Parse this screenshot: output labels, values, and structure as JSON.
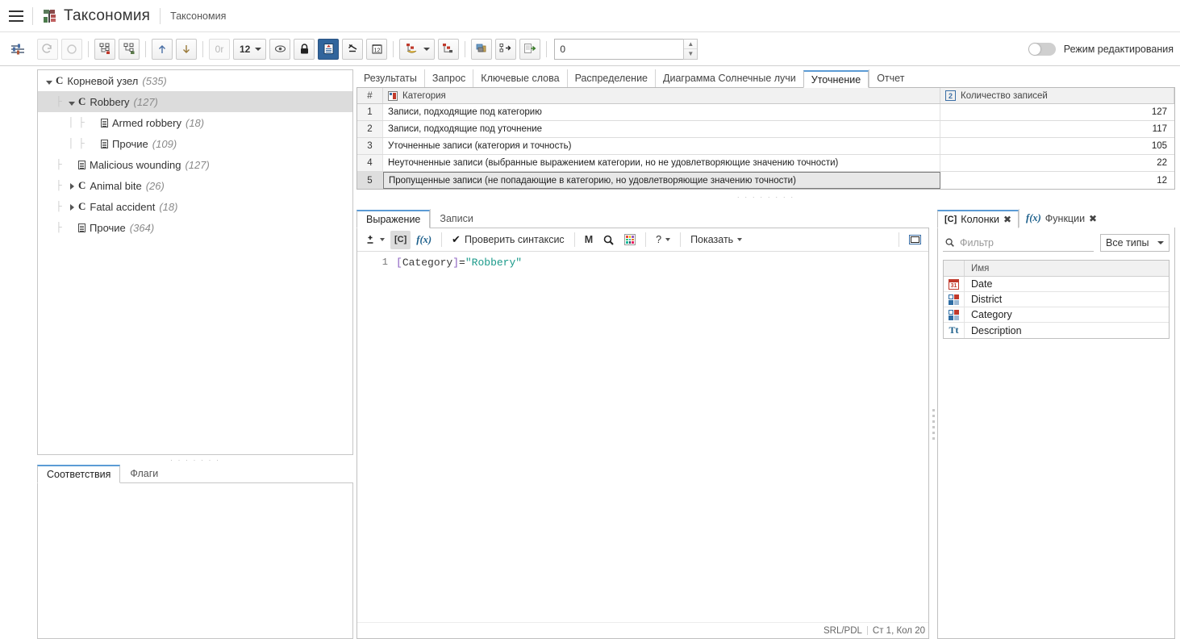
{
  "header": {
    "menu_icon": "hamburger-icon",
    "app_icon": "taxonomy-icon",
    "title": "Таксономия",
    "breadcrumb": "Таксономия"
  },
  "toolbar": {
    "settings_icon": "sliders-icon",
    "buttons": [
      {
        "name": "redo-button",
        "icon": "redo-icon",
        "glyph": "↻",
        "disabled": true
      },
      {
        "name": "undo-button",
        "icon": "undo-icon",
        "glyph": "↺",
        "disabled": true
      },
      {
        "name": "add-child-node-button",
        "icon": "add-node-icon",
        "glyph": "",
        "disabled": false
      },
      {
        "name": "add-sibling-node-button",
        "icon": "add-sibling-icon",
        "glyph": "",
        "disabled": false
      },
      {
        "name": "move-up-button",
        "icon": "arrow-up-icon",
        "glyph": "↑",
        "disabled": false
      },
      {
        "name": "move-down-button",
        "icon": "arrow-down-icon",
        "glyph": "↓",
        "disabled": false
      },
      {
        "name": "or-button",
        "icon": "or-icon",
        "glyph": "0r",
        "disabled": true
      }
    ],
    "precision_value": "12",
    "eye_icon": "eye-icon",
    "lock_icon": "lock-icon",
    "records_icon": "records-icon",
    "ratio_icon": "ratio-icon",
    "calendar12_icon": "calendar-12-icon",
    "node_tools_icon": "node-tools-icon",
    "node_export_icon": "node-export-icon",
    "layers_icon": "layers-icon",
    "node_arrow_icon": "node-arrow-icon",
    "report_icon": "report-export-icon",
    "spinner_value": "0",
    "edit_mode_label": "Режим редактирования",
    "edit_mode_on": false
  },
  "tree": {
    "nodes": [
      {
        "depth": 0,
        "expander": "down",
        "icon": "category-icon",
        "label": "Корневой узел",
        "count": "(535)",
        "selected": false
      },
      {
        "depth": 1,
        "expander": "down",
        "icon": "category-icon",
        "label": "Robbery",
        "count": "(127)",
        "selected": true
      },
      {
        "depth": 2,
        "expander": "none",
        "icon": "record-icon",
        "label": "Armed robbery",
        "count": "(18)",
        "selected": false
      },
      {
        "depth": 2,
        "expander": "none",
        "icon": "record-icon",
        "label": "Прочие",
        "count": "(109)",
        "selected": false
      },
      {
        "depth": 1,
        "expander": "none",
        "icon": "record-icon",
        "label": "Malicious wounding",
        "count": "(127)",
        "selected": false
      },
      {
        "depth": 1,
        "expander": "right",
        "icon": "category-icon",
        "label": "Animal bite",
        "count": "(26)",
        "selected": false
      },
      {
        "depth": 1,
        "expander": "right",
        "icon": "category-icon",
        "label": "Fatal accident",
        "count": "(18)",
        "selected": false
      },
      {
        "depth": 1,
        "expander": "none",
        "icon": "record-icon",
        "label": "Прочие",
        "count": "(364)",
        "selected": false
      }
    ]
  },
  "bottom_left_tabs": [
    {
      "label": "Соответствия",
      "active": true
    },
    {
      "label": "Флаги",
      "active": false
    }
  ],
  "top_tabs": [
    {
      "label": "Результаты",
      "active": false
    },
    {
      "label": "Запрос",
      "active": false
    },
    {
      "label": "Ключевые слова",
      "active": false
    },
    {
      "label": "Распределение",
      "active": false
    },
    {
      "label": "Диаграмма Солнечные лучи",
      "active": false
    },
    {
      "label": "Уточнение",
      "active": true
    },
    {
      "label": "Отчет",
      "active": false
    }
  ],
  "refinement_grid": {
    "columns": [
      {
        "key": "num",
        "label": "#",
        "icon": null
      },
      {
        "key": "category",
        "label": "Категория",
        "icon": "category-column-icon"
      },
      {
        "key": "count",
        "label": "Количество записей",
        "icon": "number-column-icon"
      }
    ],
    "rows": [
      {
        "num": "1",
        "category": "Записи, подходящие под категорию",
        "count": "127",
        "selected": false
      },
      {
        "num": "2",
        "category": "Записи, подходящие под уточнение",
        "count": "117",
        "selected": false
      },
      {
        "num": "3",
        "category": "Уточненные записи (категория и точность)",
        "count": "105",
        "selected": false
      },
      {
        "num": "4",
        "category": "Неуточненные записи (выбранные выражением категории, но не удовлетворяющие значению точности)",
        "count": "22",
        "selected": false
      },
      {
        "num": "5",
        "category": "Пропущенные записи (не попадающие в категорию, но удовлетворяющие значению точности)",
        "count": "12",
        "selected": true
      }
    ]
  },
  "expression": {
    "tabs": [
      {
        "label": "Выражение",
        "active": true
      },
      {
        "label": "Записи",
        "active": false
      }
    ],
    "toolbar": {
      "plusminus_icon": "plus-minus-icon",
      "column_icon": "column-ref-icon",
      "column_label": "[C]",
      "function_icon": "function-icon",
      "function_label": "f(x)",
      "check_syntax_label": "Проверить синтаксис",
      "check_icon": "checkmark-icon",
      "m_label": "M",
      "search_icon": "search-icon",
      "palette_icon": "color-palette-icon",
      "help_label": "?",
      "show_label": "Показать",
      "window_icon": "window-icon"
    },
    "line_number": "1",
    "code_tokens": {
      "open_bracket": "[",
      "identifier": "Category",
      "close_bracket": "]",
      "operator": "=",
      "string": "\"Robbery\""
    },
    "status": {
      "language": "SRL/PDL",
      "position": "Ст 1, Кол 20"
    }
  },
  "side_panel": {
    "tabs": [
      {
        "label": "Колонки",
        "icon_label": "[C]",
        "icon": "column-ref-icon",
        "active": true,
        "closable": true
      },
      {
        "label": "Функции",
        "icon_label": "f(x)",
        "icon": "function-icon",
        "active": false,
        "closable": true
      }
    ],
    "filter": {
      "placeholder": "Фильтр",
      "value": "",
      "search_icon": "search-icon"
    },
    "type_select": {
      "value": "Все типы",
      "caret_icon": "chevron-down-icon"
    },
    "grid": {
      "header": {
        "icon_col": "",
        "name": "Имя"
      },
      "rows": [
        {
          "icon": "date-icon",
          "name": "Date"
        },
        {
          "icon": "category-icon",
          "name": "District"
        },
        {
          "icon": "category-icon",
          "name": "Category"
        },
        {
          "icon": "text-icon",
          "name": "Description"
        }
      ]
    }
  },
  "splitters": {
    "horizontal_dots": "· · · · · · · ·",
    "left_dots": "· · · · · · ·"
  },
  "colors": {
    "accent": "#5b9bd5",
    "active_toolbar": "#31659c",
    "selection": "#dcdcdc"
  }
}
